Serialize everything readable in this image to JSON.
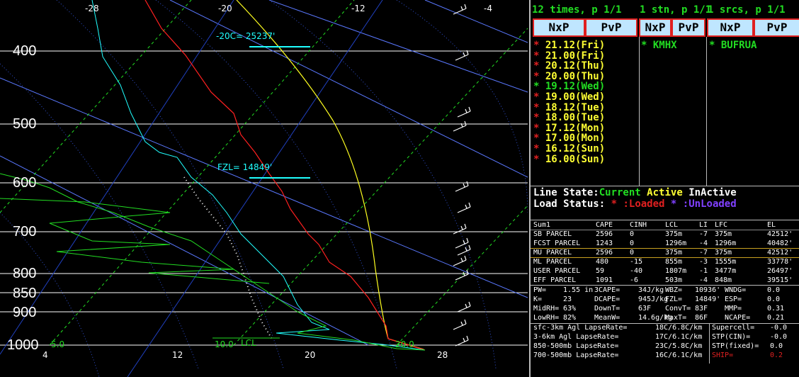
{
  "skewt": {
    "pressure_labels": [
      "400",
      "500",
      "600",
      "700",
      "800",
      "850",
      "900",
      "1000"
    ],
    "temp_top_labels": [
      "-28",
      "-20",
      "-12",
      "-4"
    ],
    "temp_bottom_labels": [
      "4",
      "12",
      "20",
      "28"
    ],
    "mixing_labels": [
      "5.0",
      "10.0",
      "20.0"
    ],
    "lcl_label": "LCL",
    "m20c_label": "-20C= 25237'",
    "fzl_label": "FZL= 14849'"
  },
  "header": {
    "times": "12 times, p 1/1",
    "stn": "1 stn, p 1/1",
    "srcs": "1 srcs, p 1/1"
  },
  "tabs": [
    "NxP",
    "PvP",
    "NxP",
    "PvP",
    "NxP",
    "PvP"
  ],
  "times_list": [
    {
      "label": "21.12(Fri)",
      "current": false
    },
    {
      "label": "21.00(Fri)",
      "current": false
    },
    {
      "label": "20.12(Thu)",
      "current": false
    },
    {
      "label": "20.00(Thu)",
      "current": false
    },
    {
      "label": "19.12(Wed)",
      "current": true
    },
    {
      "label": "19.00(Wed)",
      "current": false
    },
    {
      "label": "18.12(Tue)",
      "current": false
    },
    {
      "label": "18.00(Tue)",
      "current": false
    },
    {
      "label": "17.12(Mon)",
      "current": false
    },
    {
      "label": "17.00(Mon)",
      "current": false
    },
    {
      "label": "16.12(Sun)",
      "current": false
    },
    {
      "label": "16.00(Sun)",
      "current": false
    }
  ],
  "station": "KMHX",
  "source": "BUFRUA",
  "star": "*",
  "legend": {
    "line_state": "Line State:",
    "current": "Current",
    "active": "Active",
    "inactive": "InActive",
    "load_status": "Load Status:",
    "loaded_star": "*",
    "loaded": ":Loaded",
    "unloaded_star": "*",
    "unloaded": ":UnLoaded"
  },
  "parcel_table": {
    "headers": [
      "Sum1",
      "CAPE",
      "CINH",
      "LCL",
      "LI",
      "LFC",
      "EL"
    ],
    "rows": [
      [
        "SB PARCEL",
        "2596",
        "0",
        "375m",
        "-7",
        "375m",
        "42512'"
      ],
      [
        "FCST PARCEL",
        "1243",
        "0",
        "1296m",
        "-4",
        "1296m",
        "40482'"
      ],
      [
        "MU PARCEL",
        "2596",
        "0",
        "375m",
        "-7",
        "375m",
        "42512'"
      ],
      [
        "ML PARCEL",
        "480",
        "-15",
        "855m",
        "-3",
        "1555m",
        "33778'"
      ],
      [
        "USER PARCEL",
        "59",
        "-40",
        "1807m",
        "-1",
        "3477m",
        "26497'"
      ],
      [
        "EFF PARCEL",
        "1091",
        "-6",
        "503m",
        "-4",
        "848m",
        "39515'"
      ]
    ]
  },
  "indices": [
    [
      "PW=",
      "1.55 in",
      "3CAPE=",
      "34J/kg",
      "WBZ=",
      "10936'",
      "WNDG=",
      "0.0"
    ],
    [
      "K=",
      "23",
      "DCAPE=",
      "945J/kg",
      "FZL=",
      "14849'",
      "ESP=",
      "0.0"
    ],
    [
      "MidRH=",
      "63%",
      "DownT=",
      "63F",
      "ConvT=",
      "83F",
      "MMP=",
      "0.31"
    ],
    [
      "LowRH=",
      "82%",
      "MeanW=",
      "14.6g/kg",
      "MaxT=",
      "86F",
      "NCAPE=",
      "0.21"
    ]
  ],
  "lapse": [
    [
      "sfc-3km Agl LapseRate=",
      "18C/6.8C/km"
    ],
    [
      "3-6km Agl LapseRate=",
      "17C/6.1C/km"
    ],
    [
      "850-500mb LapseRate=",
      "23C/5.8C/km"
    ],
    [
      "700-500mb LapseRate=",
      "16C/6.1C/km"
    ]
  ],
  "stp": [
    [
      "Supercell=",
      "-0.0"
    ],
    [
      "STP(CIN)=",
      "-0.0"
    ],
    [
      "STP(fixed)=",
      "0.0"
    ],
    [
      "SHIP=",
      "0.2"
    ]
  ],
  "colors": {
    "temp": "#ff2020",
    "dewpt": "#20ffff",
    "parcel": "#ffff20",
    "wetbulb": "#ffffff",
    "dry_adiabat": "#5a78ff",
    "moist_adiabat": "#3050d0",
    "mixing": "#22dd22",
    "isobar": "#ffffff",
    "highlight": "#22dd22",
    "loaded": "#e02020",
    "unloaded": "#8040ff"
  }
}
